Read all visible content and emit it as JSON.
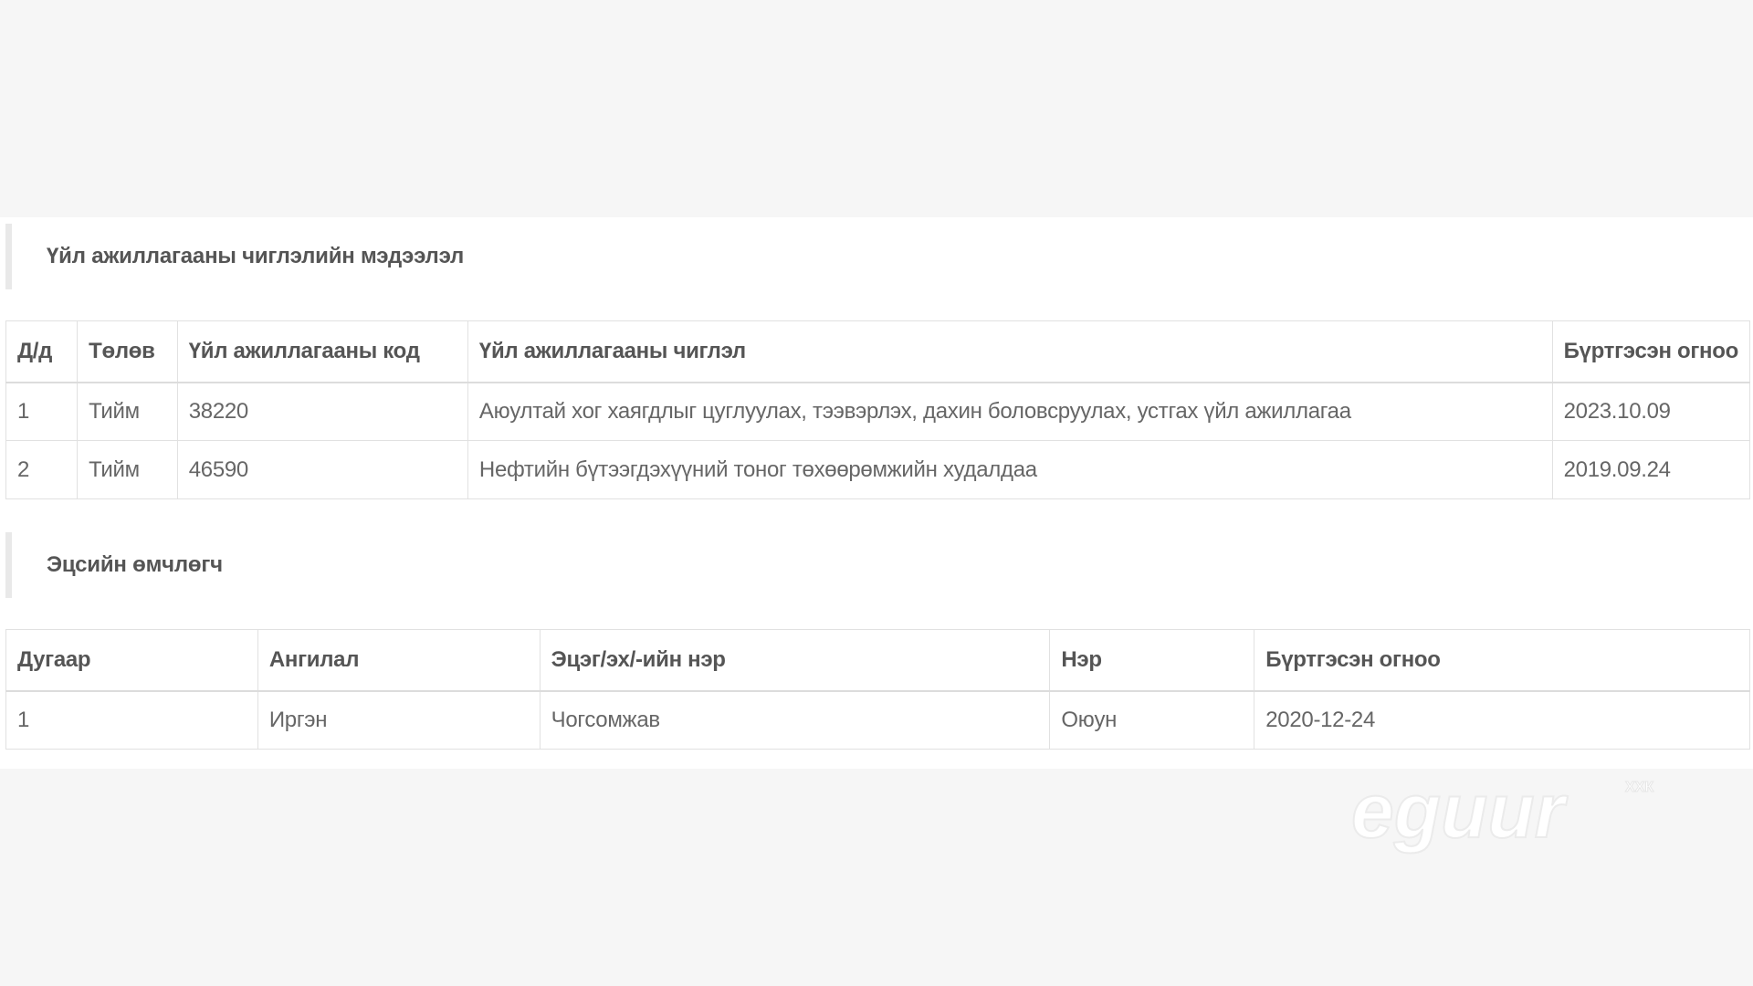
{
  "activity_section": {
    "title": "Үйл ажиллагааны чиглэлийн мэдээлэл",
    "columns": [
      "Д/д",
      "Төлөв",
      "Үйл ажиллагааны код",
      "Үйл ажиллагааны чиглэл",
      "Бүртгэсэн огноо"
    ],
    "rows": [
      [
        "1",
        "Тийм",
        "38220",
        "Аюултай хог хаягдлыг цуглуулах, тээвэрлэх, дахин боловсруулах, устгах үйл ажиллагаа",
        "2023.10.09"
      ],
      [
        "2",
        "Тийм",
        "46590",
        "Нефтийн бүтээгдэхүүний тоног төхөөрөмжийн худалдаа",
        "2019.09.24"
      ]
    ]
  },
  "owner_section": {
    "title": "Эцсийн өмчлөгч",
    "columns": [
      "Дугаар",
      "Ангилал",
      "Эцэг/эх/-ийн нэр",
      "Нэр",
      "Бүртгэсэн огноо"
    ],
    "rows": [
      [
        "1",
        "Иргэн",
        "Чогсомжав",
        "Оюун",
        "2020-12-24"
      ]
    ]
  },
  "watermark": {
    "text": "eguur",
    "superscript": "ХХК"
  }
}
